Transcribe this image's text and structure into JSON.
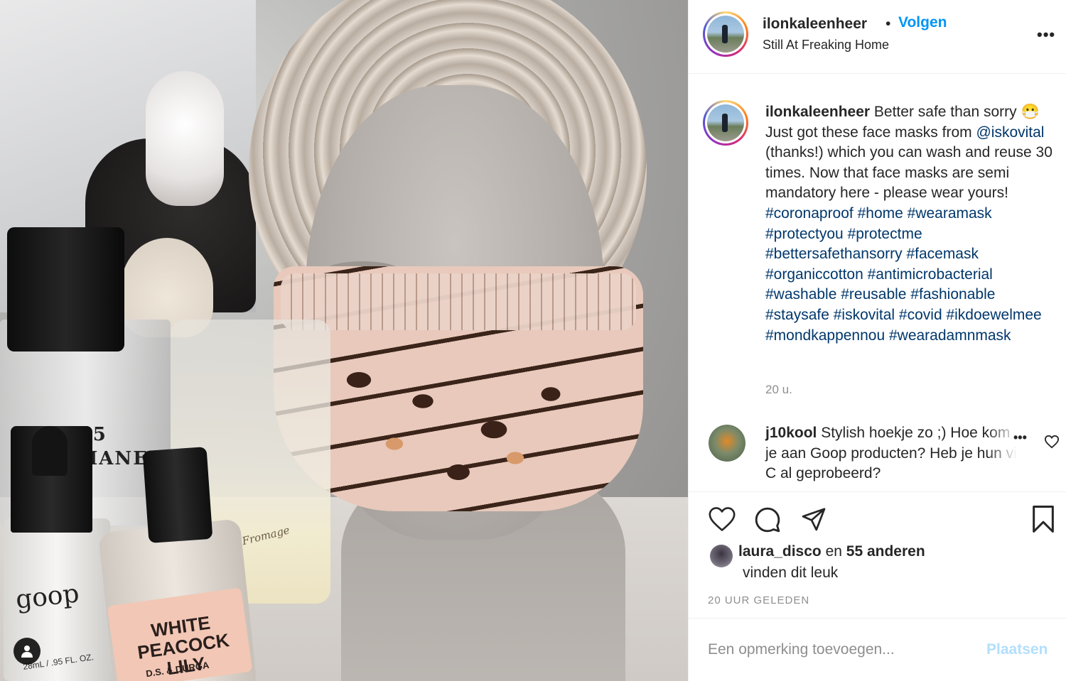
{
  "post": {
    "photo": {
      "product_labels": {
        "chanel_line1": "N°5",
        "chanel_line2": "CHANEL",
        "goop": "goop",
        "goop_size": "28mL / .95 FL. OZ.",
        "peacock_line1": "WHITE",
        "peacock_line2": "PEACOCK LILY",
        "peacock_brand": "D.S. & DURGA",
        "candle": "Petit Fromage"
      },
      "user_tag_icon": "person-icon"
    },
    "header": {
      "username": "ilonkaleenheer",
      "separator": "•",
      "follow_label": "Volgen",
      "location": "Still At Freaking Home",
      "more_icon": "more-horizontal-icon",
      "more_label": "•••"
    },
    "caption": {
      "username": "ilonkaleenheer",
      "text_part1": "Better safe than sorry 😷 Just got these face masks from",
      "mention": "@iskovital",
      "text_part2": "(thanks!) which you can wash and reuse 30 times. Now that face masks are semi mandatory here - please wear yours!",
      "hashtags": "#coronaproof #home #wearamask #protectyou #protectme #bettersafethansorry #facemask #organiccotton #antimicrobacterial #washable #reusable #fashionable #staysafe #iskovital #covid #ikdoewelmee #mondkappennou #wearadamnmask",
      "time_ago": "20 u."
    },
    "comment": {
      "username": "j10kool",
      "text": "Stylish hoekje zo ;) Hoe kom je aan Goop producten? Heb je hun vit C al geprobeerd?",
      "more_label": "•••",
      "heart_icon": "heart-outline-icon"
    },
    "actions": {
      "like_icon": "heart-outline-icon",
      "comment_icon": "comment-bubble-icon",
      "share_icon": "paper-plane-icon",
      "save_icon": "bookmark-icon",
      "likes_user": "laura_disco",
      "likes_connector": "en",
      "likes_others": "55 anderen",
      "likes_suffix": "vinden dit leuk",
      "timestamp": "20 UUR GELEDEN"
    },
    "add_comment": {
      "placeholder": "Een opmerking toevoegen...",
      "post_label": "Plaatsen"
    },
    "colors": {
      "link_blue": "#0095f6",
      "hashtag_blue": "#00376b",
      "post_disabled": "#b2dffc",
      "muted_gray": "#8e8e8e"
    }
  }
}
